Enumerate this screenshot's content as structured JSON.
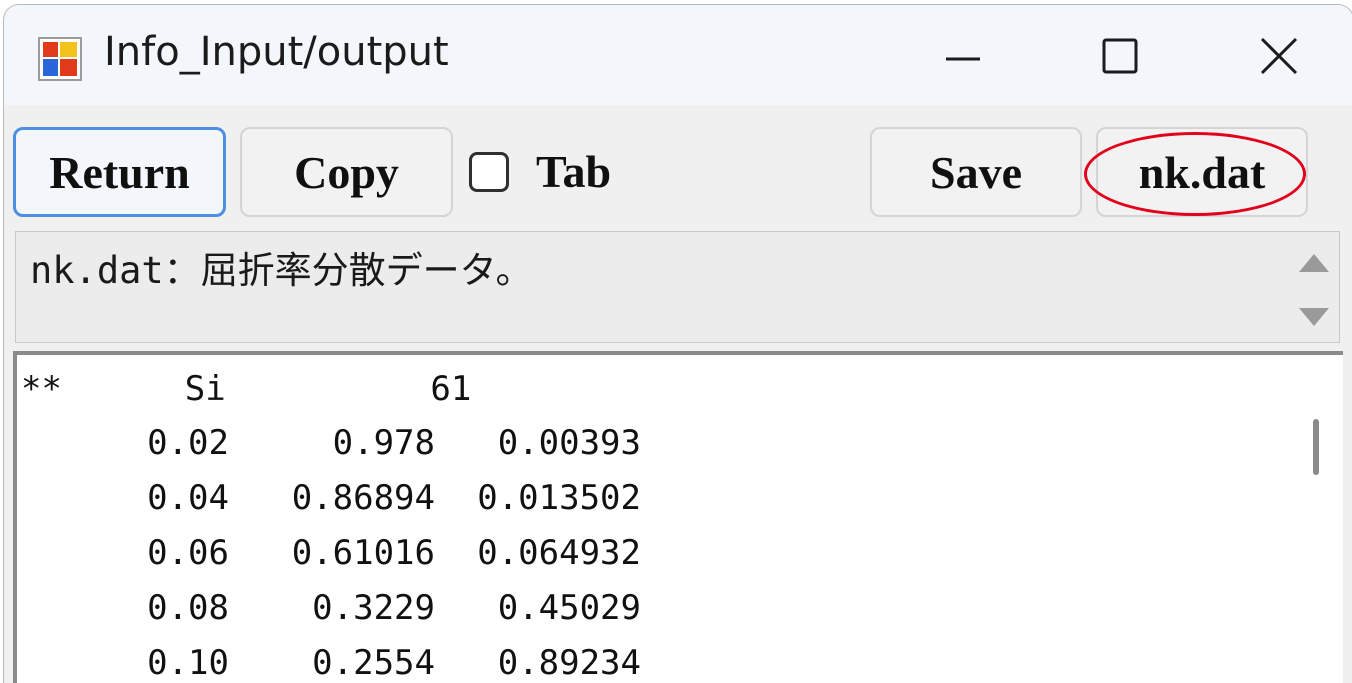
{
  "window": {
    "title": "Info_Input/output"
  },
  "toolbar": {
    "return_label": "Return",
    "copy_label": "Copy",
    "tab_checkbox_label": "Tab",
    "tab_checked": false,
    "save_label": "Save",
    "nk_label": "nk.dat"
  },
  "info": {
    "text": "nk.dat：屈折率分散データ。"
  },
  "output": {
    "header": "**      Si          61",
    "rows": [
      {
        "c1": "0.02",
        "c2": "0.978",
        "c3": "0.00393"
      },
      {
        "c1": "0.04",
        "c2": "0.86894",
        "c3": "0.013502"
      },
      {
        "c1": "0.06",
        "c2": "0.61016",
        "c3": "0.064932"
      },
      {
        "c1": "0.08",
        "c2": "0.3229",
        "c3": "0.45029"
      },
      {
        "c1": "0.10",
        "c2": "0.2554",
        "c3": "0.89234"
      }
    ]
  },
  "colors": {
    "annotation": "#e3001b",
    "focus_border": "#4d8fe0"
  },
  "icons": [
    "app-icon",
    "minimize-icon",
    "maximize-icon",
    "close-icon",
    "scroll-up-icon",
    "scroll-down-icon"
  ]
}
